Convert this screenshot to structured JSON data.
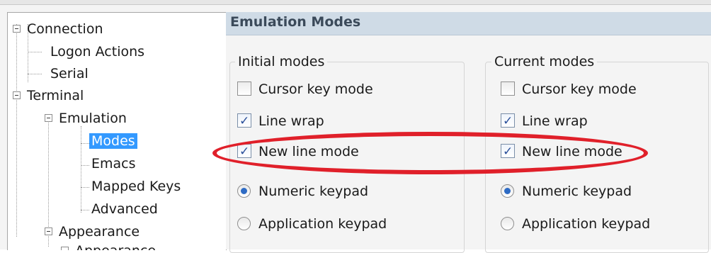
{
  "tree": {
    "items": [
      {
        "label": "Connection",
        "depth": 0,
        "expander": true
      },
      {
        "label": "Logon Actions",
        "depth": 1
      },
      {
        "label": "Serial",
        "depth": 1
      },
      {
        "label": "Terminal",
        "depth": 0,
        "expander": true
      },
      {
        "label": "Emulation",
        "depth": 1,
        "expander": true
      },
      {
        "label": "Modes",
        "depth": 2,
        "selected": true
      },
      {
        "label": "Emacs",
        "depth": 2
      },
      {
        "label": "Mapped Keys",
        "depth": 2
      },
      {
        "label": "Advanced",
        "depth": 2
      },
      {
        "label": "Appearance",
        "depth": 1,
        "expander": true
      },
      {
        "label": "Appearance",
        "depth": 2,
        "partial": true
      }
    ]
  },
  "panel": {
    "title": "Emulation Modes",
    "initial": {
      "title": "Initial modes",
      "cursor_key_mode": {
        "label": "Cursor key mode",
        "checked": false
      },
      "line_wrap": {
        "label": "Line wrap",
        "checked": true
      },
      "new_line_mode": {
        "label": "New line mode",
        "checked": true
      },
      "numeric_keypad": {
        "label": "Numeric keypad",
        "selected": true
      },
      "application_keypad": {
        "label": "Application keypad",
        "selected": false
      }
    },
    "current": {
      "title": "Current modes",
      "cursor_key_mode": {
        "label": "Cursor key mode",
        "checked": false
      },
      "line_wrap": {
        "label": "Line wrap",
        "checked": true
      },
      "new_line_mode": {
        "label": "New line mode",
        "checked": true
      },
      "numeric_keypad": {
        "label": "Numeric keypad",
        "selected": true
      },
      "application_keypad": {
        "label": "Application keypad",
        "selected": false
      }
    }
  },
  "annotation": {
    "color": "#e0202a",
    "shape": "ellipse"
  },
  "colors": {
    "header_bg": "#cfdbe6",
    "selection": "#3399ff",
    "check": "#2a4f9a",
    "radio_dot": "#2e6bc4"
  }
}
